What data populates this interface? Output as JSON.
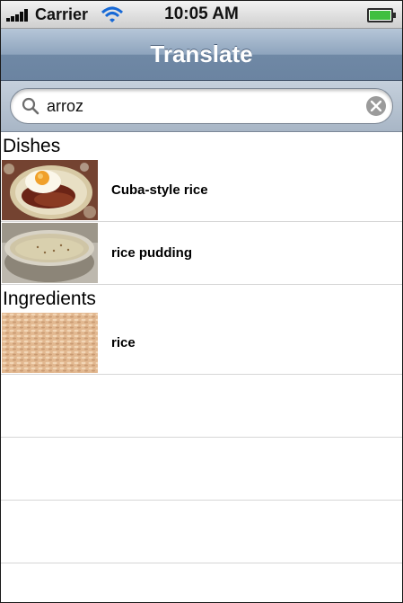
{
  "status_bar": {
    "carrier": "Carrier",
    "time": "10:05 AM",
    "signal_icon": "signal-bars-icon",
    "wifi_icon": "wifi-icon",
    "battery_icon": "battery-icon",
    "battery_level": 1.0,
    "battery_color": "#3fbf3f"
  },
  "nav": {
    "title": "Translate",
    "color": "#7b93af"
  },
  "search": {
    "value": "arroz",
    "placeholder": ""
  },
  "sections": [
    {
      "title": "Dishes",
      "items": [
        {
          "label": "Cuba-style rice",
          "image": "fried-egg-rice-photo"
        },
        {
          "label": "rice pudding",
          "image": "rice-pudding-photo"
        }
      ]
    },
    {
      "title": "Ingredients",
      "items": [
        {
          "label": "rice",
          "image": "raw-rice-photo"
        }
      ]
    }
  ]
}
